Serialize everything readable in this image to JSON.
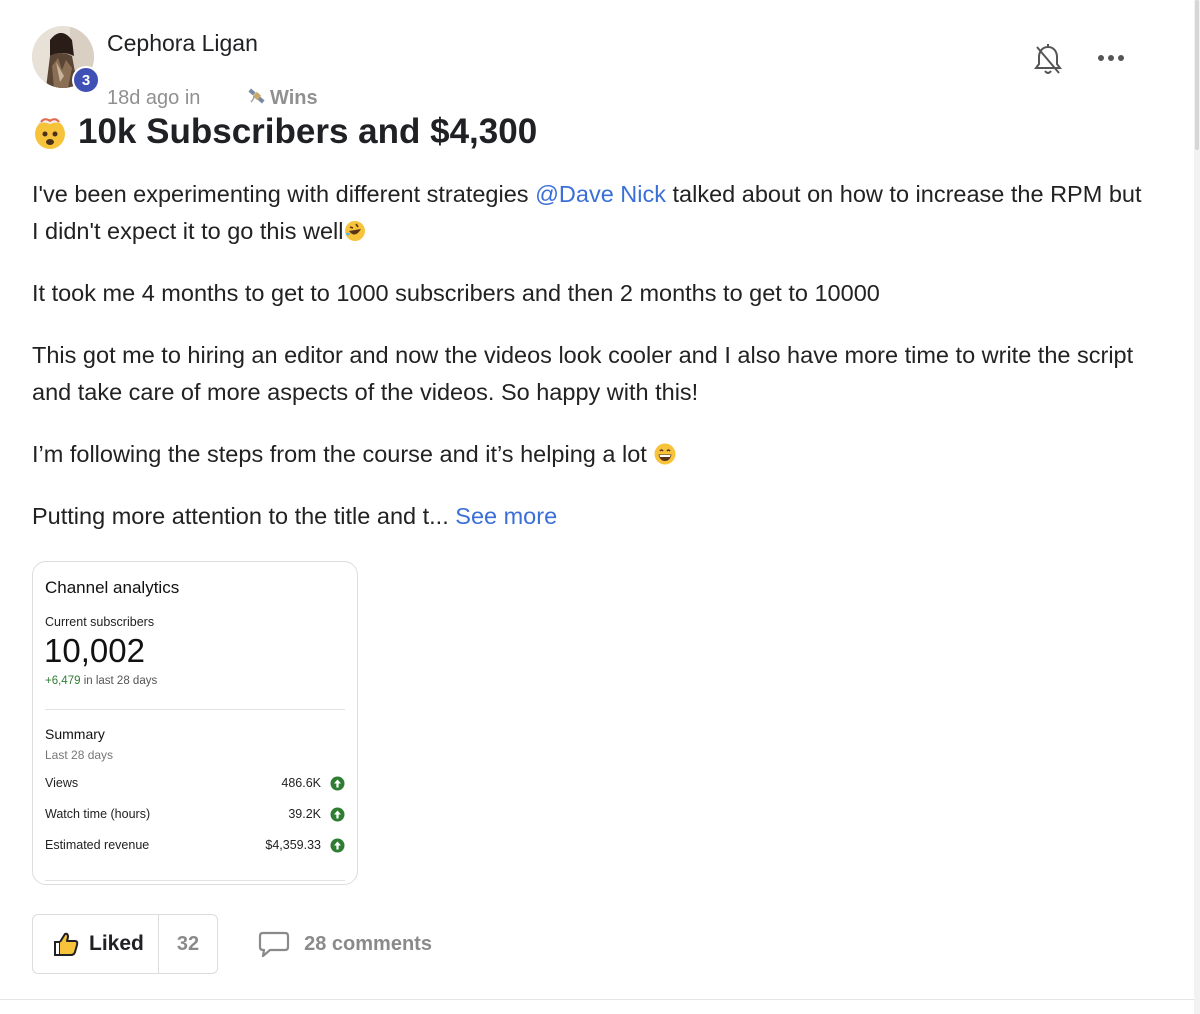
{
  "post": {
    "author": "Cephora Ligan",
    "level": "3",
    "time_ago": "18d ago in ",
    "category": "Wins",
    "category_icon": "satellite-icon",
    "title_emoji": "exploding-head-emoji",
    "title": "10k Subscribers and $4,300",
    "body": {
      "p1_before": "I've been experimenting with different strategies ",
      "p1_mention": "@Dave Nick",
      "p1_after": " talked about on how to increase the RPM but I didn't expect it to go this well",
      "p2": "It took me 4 months to get to 1000 subscribers and then 2 months to get to 10000",
      "p3": "This got me to hiring an editor and now the videos look cooler and I also have more time to write the script and take care of more aspects of the videos. So happy with this!",
      "p4": "I’m following the steps from the course and it’s helping a lot ",
      "p5": "Putting more attention to the title and t...",
      "see_more": "See more"
    }
  },
  "analytics": {
    "title": "Channel analytics",
    "subscribers_label": "Current subscribers",
    "subscribers": "10,002",
    "change_delta": "+6,479",
    "change_label": " in last 28 days",
    "summary_title": "Summary",
    "summary_period": "Last 28 days",
    "rows": [
      {
        "label": "Views",
        "value": "486.6K"
      },
      {
        "label": "Watch time (hours)",
        "value": "39.2K"
      },
      {
        "label": "Estimated revenue",
        "value": "$4,359.33"
      }
    ],
    "trend_color": "#2e7d32"
  },
  "actions": {
    "like_label": "Liked",
    "like_count": "32",
    "comments_label": "28 comments"
  },
  "colors": {
    "link": "#3b6fd8",
    "level_badge": "#3f51b5"
  }
}
